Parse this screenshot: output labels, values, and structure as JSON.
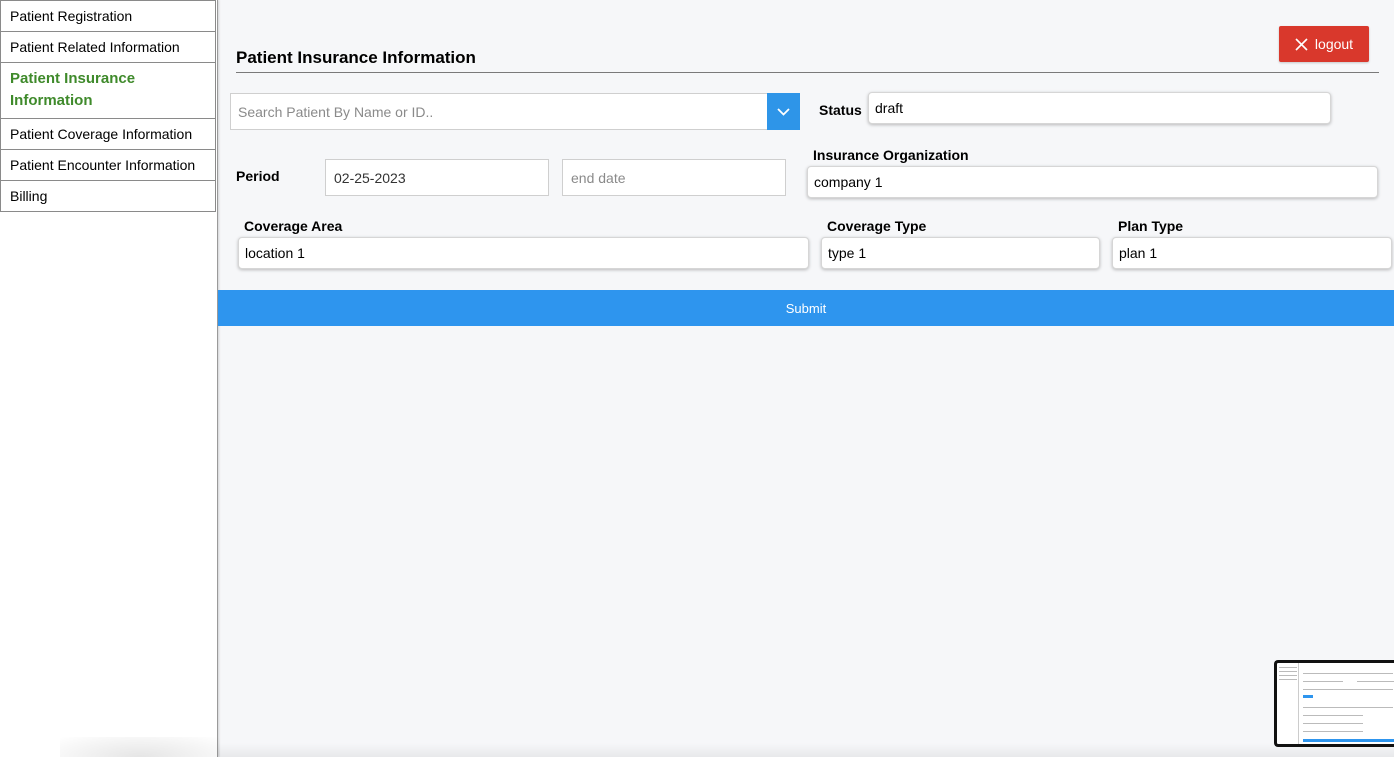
{
  "sidebar": {
    "items": [
      {
        "label": "Patient Registration",
        "active": false
      },
      {
        "label": "Patient Related Information",
        "active": false
      },
      {
        "label": "Patient Insurance Information",
        "active": true
      },
      {
        "label": "Patient Coverage Information",
        "active": false
      },
      {
        "label": "Patient Encounter Information",
        "active": false
      },
      {
        "label": "Billing",
        "active": false
      }
    ]
  },
  "header": {
    "title": "Patient Insurance Information",
    "logout_label": "logout"
  },
  "form": {
    "search": {
      "placeholder": "Search Patient By Name or ID..",
      "value": ""
    },
    "status": {
      "label": "Status",
      "value": "draft"
    },
    "period": {
      "label": "Period",
      "start": "02-25-2023",
      "end_placeholder": "end date"
    },
    "insurance_org": {
      "label": "Insurance Organization",
      "value": "company 1"
    },
    "coverage_area": {
      "label": "Coverage Area",
      "value": "location 1"
    },
    "coverage_type": {
      "label": "Coverage Type",
      "value": "type 1"
    },
    "plan_type": {
      "label": "Plan Type",
      "value": "plan 1"
    },
    "submit_label": "Submit"
  },
  "colors": {
    "active_nav": "#3f8a2b",
    "logout": "#d9382c",
    "primary": "#2e95ee"
  },
  "icons": {
    "logout": "close-icon",
    "dropdown": "chevron-down-icon"
  }
}
